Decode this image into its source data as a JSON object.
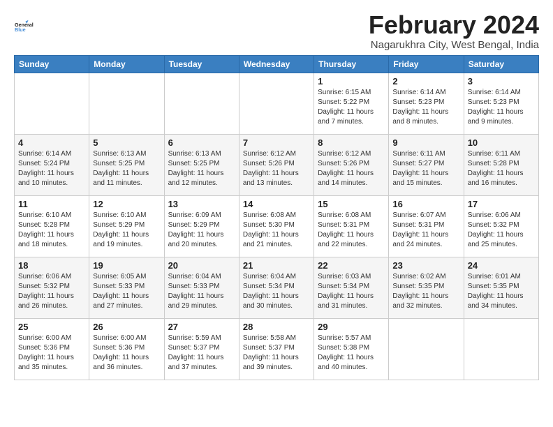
{
  "header": {
    "logo_line1": "General",
    "logo_line2": "Blue",
    "month_year": "February 2024",
    "location": "Nagarukhra City, West Bengal, India"
  },
  "weekdays": [
    "Sunday",
    "Monday",
    "Tuesday",
    "Wednesday",
    "Thursday",
    "Friday",
    "Saturday"
  ],
  "weeks": [
    [
      {
        "day": "",
        "info": ""
      },
      {
        "day": "",
        "info": ""
      },
      {
        "day": "",
        "info": ""
      },
      {
        "day": "",
        "info": ""
      },
      {
        "day": "1",
        "info": "Sunrise: 6:15 AM\nSunset: 5:22 PM\nDaylight: 11 hours\nand 7 minutes."
      },
      {
        "day": "2",
        "info": "Sunrise: 6:14 AM\nSunset: 5:23 PM\nDaylight: 11 hours\nand 8 minutes."
      },
      {
        "day": "3",
        "info": "Sunrise: 6:14 AM\nSunset: 5:23 PM\nDaylight: 11 hours\nand 9 minutes."
      }
    ],
    [
      {
        "day": "4",
        "info": "Sunrise: 6:14 AM\nSunset: 5:24 PM\nDaylight: 11 hours\nand 10 minutes."
      },
      {
        "day": "5",
        "info": "Sunrise: 6:13 AM\nSunset: 5:25 PM\nDaylight: 11 hours\nand 11 minutes."
      },
      {
        "day": "6",
        "info": "Sunrise: 6:13 AM\nSunset: 5:25 PM\nDaylight: 11 hours\nand 12 minutes."
      },
      {
        "day": "7",
        "info": "Sunrise: 6:12 AM\nSunset: 5:26 PM\nDaylight: 11 hours\nand 13 minutes."
      },
      {
        "day": "8",
        "info": "Sunrise: 6:12 AM\nSunset: 5:26 PM\nDaylight: 11 hours\nand 14 minutes."
      },
      {
        "day": "9",
        "info": "Sunrise: 6:11 AM\nSunset: 5:27 PM\nDaylight: 11 hours\nand 15 minutes."
      },
      {
        "day": "10",
        "info": "Sunrise: 6:11 AM\nSunset: 5:28 PM\nDaylight: 11 hours\nand 16 minutes."
      }
    ],
    [
      {
        "day": "11",
        "info": "Sunrise: 6:10 AM\nSunset: 5:28 PM\nDaylight: 11 hours\nand 18 minutes."
      },
      {
        "day": "12",
        "info": "Sunrise: 6:10 AM\nSunset: 5:29 PM\nDaylight: 11 hours\nand 19 minutes."
      },
      {
        "day": "13",
        "info": "Sunrise: 6:09 AM\nSunset: 5:29 PM\nDaylight: 11 hours\nand 20 minutes."
      },
      {
        "day": "14",
        "info": "Sunrise: 6:08 AM\nSunset: 5:30 PM\nDaylight: 11 hours\nand 21 minutes."
      },
      {
        "day": "15",
        "info": "Sunrise: 6:08 AM\nSunset: 5:31 PM\nDaylight: 11 hours\nand 22 minutes."
      },
      {
        "day": "16",
        "info": "Sunrise: 6:07 AM\nSunset: 5:31 PM\nDaylight: 11 hours\nand 24 minutes."
      },
      {
        "day": "17",
        "info": "Sunrise: 6:06 AM\nSunset: 5:32 PM\nDaylight: 11 hours\nand 25 minutes."
      }
    ],
    [
      {
        "day": "18",
        "info": "Sunrise: 6:06 AM\nSunset: 5:32 PM\nDaylight: 11 hours\nand 26 minutes."
      },
      {
        "day": "19",
        "info": "Sunrise: 6:05 AM\nSunset: 5:33 PM\nDaylight: 11 hours\nand 27 minutes."
      },
      {
        "day": "20",
        "info": "Sunrise: 6:04 AM\nSunset: 5:33 PM\nDaylight: 11 hours\nand 29 minutes."
      },
      {
        "day": "21",
        "info": "Sunrise: 6:04 AM\nSunset: 5:34 PM\nDaylight: 11 hours\nand 30 minutes."
      },
      {
        "day": "22",
        "info": "Sunrise: 6:03 AM\nSunset: 5:34 PM\nDaylight: 11 hours\nand 31 minutes."
      },
      {
        "day": "23",
        "info": "Sunrise: 6:02 AM\nSunset: 5:35 PM\nDaylight: 11 hours\nand 32 minutes."
      },
      {
        "day": "24",
        "info": "Sunrise: 6:01 AM\nSunset: 5:35 PM\nDaylight: 11 hours\nand 34 minutes."
      }
    ],
    [
      {
        "day": "25",
        "info": "Sunrise: 6:00 AM\nSunset: 5:36 PM\nDaylight: 11 hours\nand 35 minutes."
      },
      {
        "day": "26",
        "info": "Sunrise: 6:00 AM\nSunset: 5:36 PM\nDaylight: 11 hours\nand 36 minutes."
      },
      {
        "day": "27",
        "info": "Sunrise: 5:59 AM\nSunset: 5:37 PM\nDaylight: 11 hours\nand 37 minutes."
      },
      {
        "day": "28",
        "info": "Sunrise: 5:58 AM\nSunset: 5:37 PM\nDaylight: 11 hours\nand 39 minutes."
      },
      {
        "day": "29",
        "info": "Sunrise: 5:57 AM\nSunset: 5:38 PM\nDaylight: 11 hours\nand 40 minutes."
      },
      {
        "day": "",
        "info": ""
      },
      {
        "day": "",
        "info": ""
      }
    ]
  ]
}
